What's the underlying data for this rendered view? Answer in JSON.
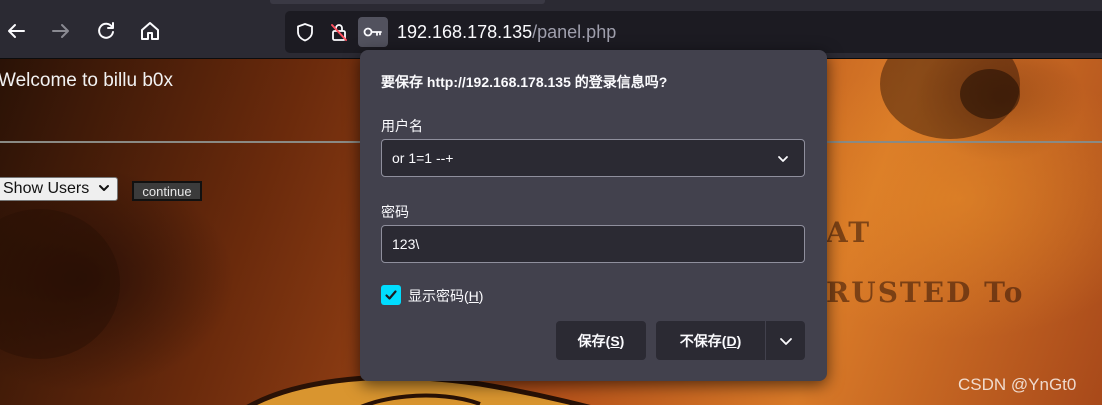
{
  "toolbar": {
    "back_icon": "arrow-left-icon",
    "forward_icon": "arrow-right-icon",
    "reload_icon": "reload-icon",
    "home_icon": "home-icon",
    "url_host": "192.168.178.135",
    "url_path": "/panel.php"
  },
  "page": {
    "welcome": "Welcome to billu b0x",
    "select_value": "Show Users",
    "continue_label": "continue",
    "background_text_1": "AT",
    "background_text_2": "RUSTED To"
  },
  "dialog": {
    "title": "要保存 http://192.168.178.135 的登录信息吗?",
    "username_label": "用户名",
    "username_value": "or 1=1 --+",
    "password_label": "密码",
    "password_value": "123\\",
    "show_password_label": "显示密码(",
    "show_password_key": "H",
    "show_password_end": ")",
    "save_label": "保存(",
    "save_key": "S",
    "save_end": ")",
    "nosave_label": "不保存(",
    "nosave_key": "D",
    "nosave_end": ")",
    "show_password_checked": true
  },
  "watermark": "CSDN @YnGt0",
  "colors": {
    "toolbar": "#2b2a33",
    "dialog": "#42414d",
    "accent": "#00ddff"
  }
}
